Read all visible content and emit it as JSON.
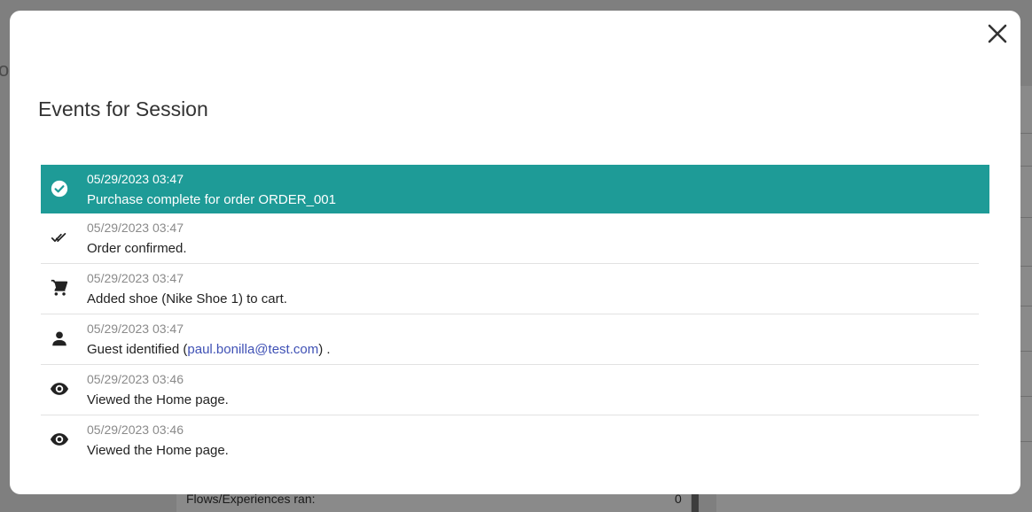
{
  "modal": {
    "title": "Events for Session",
    "close_icon": "close-icon"
  },
  "events": [
    {
      "timestamp": "05/29/2023 03:47",
      "message": "Purchase complete for order ORDER_001",
      "icon": "check-circle-icon",
      "active": true
    },
    {
      "timestamp": "05/29/2023 03:47",
      "message": "Order confirmed.",
      "icon": "double-check-icon"
    },
    {
      "timestamp": "05/29/2023 03:47",
      "message": "Added shoe (Nike Shoe 1) to cart.",
      "icon": "cart-icon"
    },
    {
      "timestamp": "05/29/2023 03:47",
      "message_prefix": "Guest identified (",
      "email": "paul.bonilla@test.com",
      "message_suffix": ") .",
      "icon": "person-icon"
    },
    {
      "timestamp": "05/29/2023 03:46",
      "message": "Viewed the Home page.",
      "icon": "eye-icon"
    },
    {
      "timestamp": "05/29/2023 03:46",
      "message": "Viewed the Home page.",
      "icon": "eye-icon"
    }
  ],
  "background": {
    "left_fragment": "o",
    "bottom_label": "Flows/Experiences ran:",
    "bottom_value": "0"
  },
  "colors": {
    "accent": "#1e9b97",
    "link": "#3f51b5",
    "overlay": "#7f7f7f"
  }
}
